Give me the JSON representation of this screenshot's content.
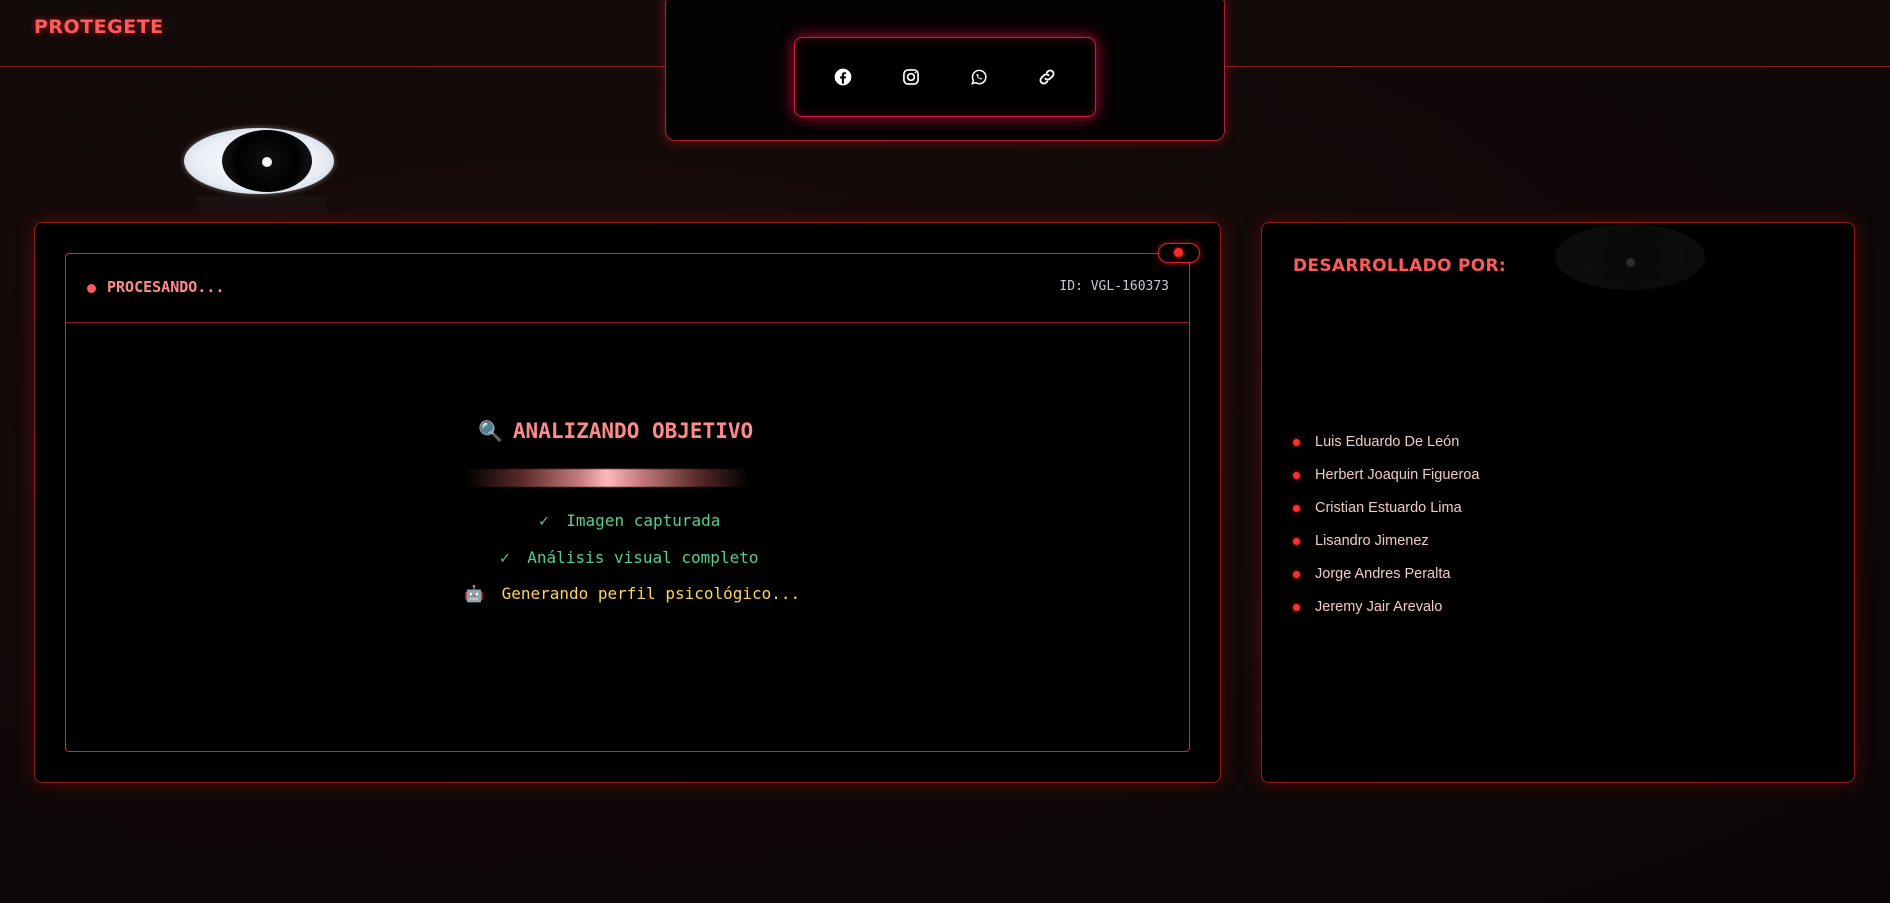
{
  "header": {
    "brand": "PROTEGETE"
  },
  "social": {
    "icons": [
      "facebook-icon",
      "instagram-icon",
      "whatsapp-icon",
      "link-icon"
    ]
  },
  "analysis": {
    "status": "PROCESANDO...",
    "id_label": "ID: VGL-160373",
    "title": "ANALIZANDO OBJETIVO",
    "steps": [
      {
        "icon": "✓",
        "text": "Imagen capturada",
        "state": "done"
      },
      {
        "icon": "✓",
        "text": "Análisis visual completo",
        "state": "done"
      },
      {
        "icon": "🤖",
        "text": "Generando perfil psicológico...",
        "state": "pending"
      }
    ]
  },
  "developers": {
    "title": "DESARROLLADO POR:",
    "names": [
      "Luis Eduardo De León",
      "Herbert Joaquin Figueroa",
      "Cristian Estuardo Lima",
      "Lisandro Jimenez",
      "Jorge Andres Peralta",
      "Jeremy Jair Arevalo"
    ]
  },
  "colors": {
    "accent": "#ff5a5a",
    "border": "#d7253a",
    "success": "#54cf8c",
    "pending": "#ffd45c"
  }
}
